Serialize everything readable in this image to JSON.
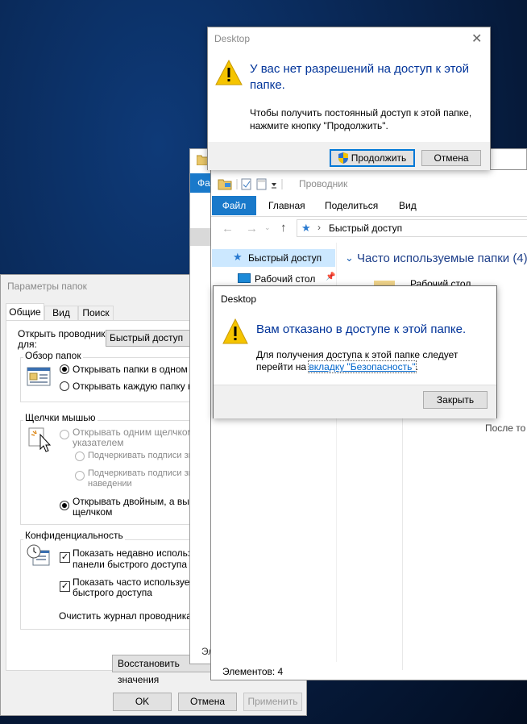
{
  "folder_options": {
    "title": "Параметры папок",
    "tabs": [
      "Общие",
      "Вид",
      "Поиск"
    ],
    "open_explorer_label": "Открыть проводник\nдля:",
    "open_explorer_value": "Быстрый доступ",
    "browse_group": "Обзор папок",
    "browse_option1": "Открывать папки в одном и т",
    "browse_option2": "Открывать каждую папку в о",
    "click_group": "Щелчки мышью",
    "click_single": "Открывать одним щелчком, в",
    "click_single2": "указателем",
    "underline1": "Подчеркивать подписи зн",
    "underline2a": "Подчеркивать подписи зн",
    "underline2b": "наведении",
    "click_double": "Открывать двойным, а выде",
    "click_double2": "щелчком",
    "privacy_group": "Конфиденциальность",
    "privacy_recent": "Показать недавно использо",
    "privacy_recent2": "панели быстрого доступа",
    "privacy_frequent": "Показать часто используемы",
    "privacy_frequent2": "быстрого доступа",
    "clear_history": "Очистить журнал проводника",
    "restore_defaults": "Восстановить значения",
    "ok": "OK",
    "cancel": "Отмена",
    "apply": "Применить"
  },
  "back_window": {
    "tab_partial": "Фа",
    "status_partial": "Эл"
  },
  "explorer": {
    "title": "Проводник",
    "ribbon_tabs": [
      "Файл",
      "Главная",
      "Поделиться",
      "Вид"
    ],
    "address": "Быстрый доступ",
    "nav_quick_access": "Быстрый доступ",
    "nav_desktop": "Рабочий стол",
    "section_header": "Часто используемые папки (4)",
    "folder_desktop": "Рабочий стол",
    "after_text": "После то",
    "status": "Элементов: 4"
  },
  "uac_dialog": {
    "title": "Desktop",
    "heading": "У вас нет разрешений на доступ к этой папке.",
    "body": "Чтобы получить постоянный доступ к этой папке, нажмите кнопку \"Продолжить\".",
    "continue": "Продолжить",
    "cancel": "Отмена"
  },
  "denied_dialog": {
    "title": "Desktop",
    "heading": "Вам отказано в доступе к этой папке.",
    "body_line1": "Для получения доступа к этой папке следует",
    "body_line2_prefix": "перейти на ",
    "link": "вкладку \"Безопасность\"",
    "body_line2_suffix": ".",
    "close": "Закрыть"
  },
  "colors": {
    "accent": "#0078d7",
    "heading_blue": "#003399",
    "link": "#0066cc",
    "warning_yellow": "#f5c400"
  }
}
